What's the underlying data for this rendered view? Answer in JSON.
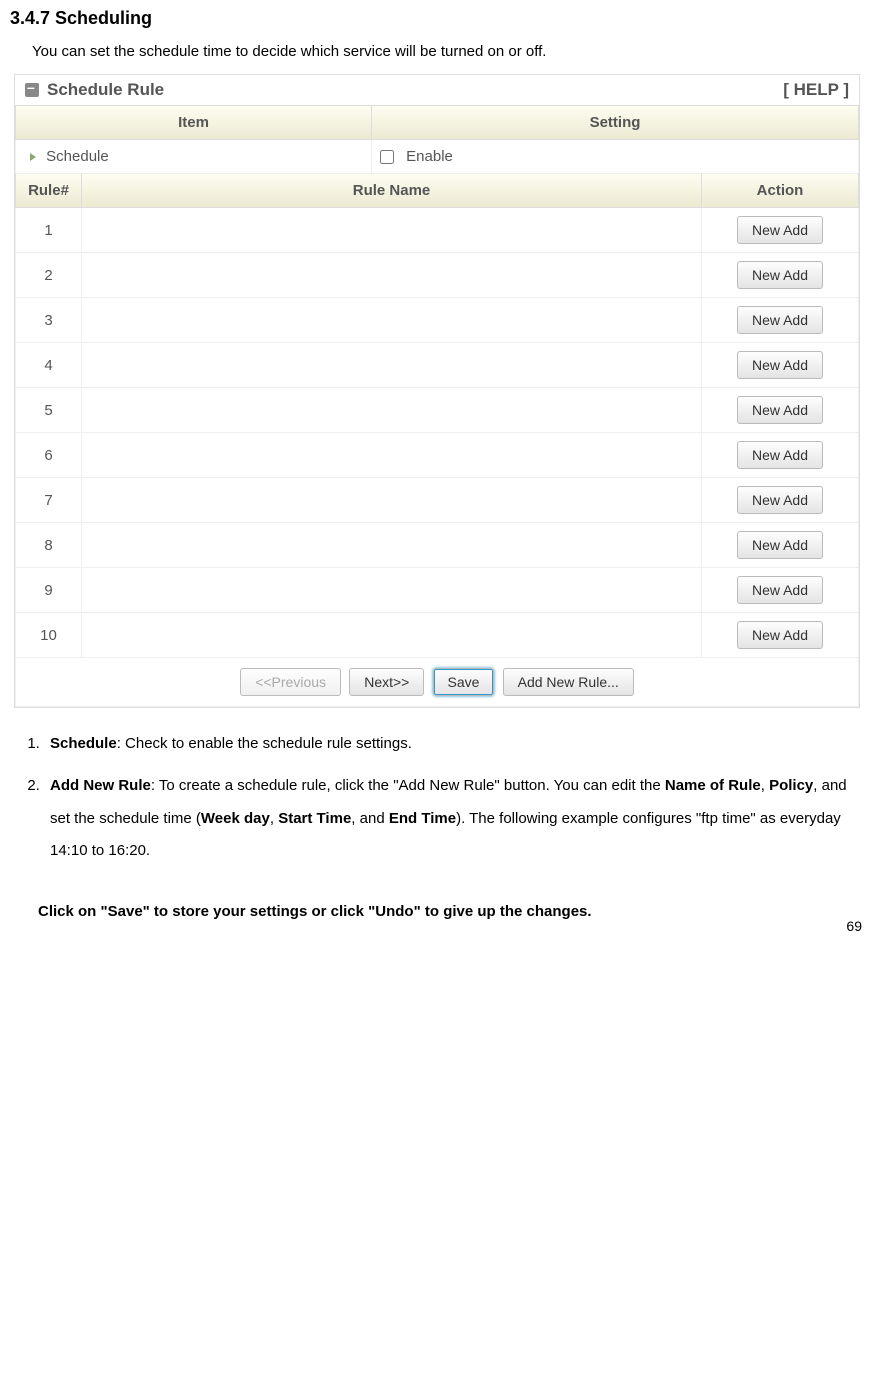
{
  "heading": "3.4.7 Scheduling",
  "intro": "You can set the schedule time to decide which service will be turned on or off.",
  "panel": {
    "title": "Schedule Rule",
    "help": "[ HELP ]",
    "item_setting_header": {
      "item": "Item",
      "setting": "Setting"
    },
    "schedule_row": {
      "label": "Schedule",
      "enable_label": "Enable",
      "enabled": false
    },
    "rule_header": {
      "num": "Rule#",
      "name": "Rule Name",
      "action": "Action"
    },
    "rules": [
      {
        "num": "1",
        "name": "",
        "action": "New Add"
      },
      {
        "num": "2",
        "name": "",
        "action": "New Add"
      },
      {
        "num": "3",
        "name": "",
        "action": "New Add"
      },
      {
        "num": "4",
        "name": "",
        "action": "New Add"
      },
      {
        "num": "5",
        "name": "",
        "action": "New Add"
      },
      {
        "num": "6",
        "name": "",
        "action": "New Add"
      },
      {
        "num": "7",
        "name": "",
        "action": "New Add"
      },
      {
        "num": "8",
        "name": "",
        "action": "New Add"
      },
      {
        "num": "9",
        "name": "",
        "action": "New Add"
      },
      {
        "num": "10",
        "name": "",
        "action": "New Add"
      }
    ],
    "buttons": {
      "prev": "<<Previous",
      "next": "Next>>",
      "save": "Save",
      "addnew": "Add New Rule..."
    }
  },
  "list": [
    {
      "lead_bold": "Schedule",
      "rest": ": Check to enable the schedule rule settings."
    },
    {
      "lead_bold": "Add New Rule",
      "rest_parts": [
        ": To create a schedule rule, click the \"Add New Rule\" button. You can edit the ",
        "Name of Rule",
        ", ",
        "Policy",
        ", and set the schedule time (",
        "Week day",
        ", ",
        "Start Time",
        ", and ",
        "End Time",
        "). The following example configures \"ftp time\" as everyday 14:10 to 16:20."
      ],
      "bold_idx": [
        1,
        3,
        5,
        7,
        9
      ]
    }
  ],
  "closing": "Click on \"Save\" to store your settings or click \"Undo\" to give up the changes.",
  "page_number": "69"
}
